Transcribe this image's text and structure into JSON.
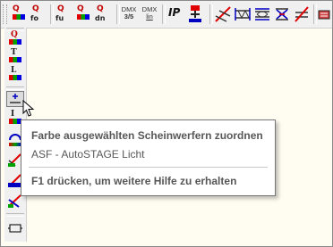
{
  "toolbar_top": {
    "buttons": [
      {
        "name": "q-rgb",
        "q": "Q"
      },
      {
        "name": "q-fo",
        "q": "Q",
        "sub": "fo"
      },
      {
        "name": "q-fu",
        "q": "Q",
        "sub": "fu"
      },
      {
        "name": "q-dn",
        "q": "Q",
        "sub": "dn"
      },
      {
        "name": "dmx-35",
        "line1": "DMX",
        "line2": "3/5"
      },
      {
        "name": "dmx-lin",
        "line1": "DMX",
        "line2": "lin"
      },
      {
        "name": "ip",
        "label": "IP"
      }
    ]
  },
  "toolbar_left": {
    "letters": [
      "Q",
      "T",
      "L",
      "I"
    ]
  },
  "tooltip": {
    "title": "Farbe ausgewählten Scheinwerfern zuordnen",
    "body": "ASF - AutoSTAGE Licht",
    "footer": "F1 drücken, um weitere Hilfe zu erhalten"
  },
  "colors": {
    "background": "#fffdf2",
    "toolbar": "#f0f0f0",
    "tooltip_text": "#575757",
    "red": "#e00000",
    "green": "#00a000",
    "blue": "#0000e0"
  }
}
